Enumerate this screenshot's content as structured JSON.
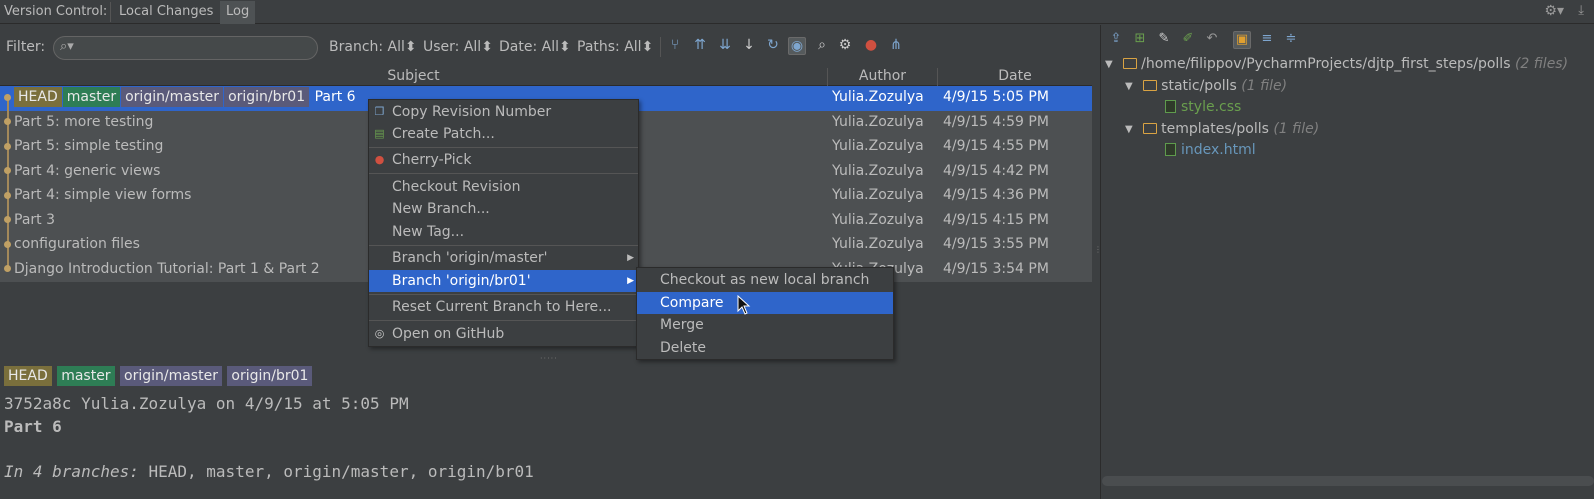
{
  "topbar": {
    "title": "Version Control:",
    "tabs": [
      "Local Changes",
      "Log"
    ],
    "active_tab": "Log"
  },
  "toolbar": {
    "filter_label": "Filter:",
    "filter_value": "",
    "branch": "Branch: All",
    "user": "User: All",
    "date": "Date: All",
    "paths": "Paths: All",
    "icons": [
      "graph-icon",
      "collapse-icon",
      "expand-icon",
      "arrow-down-icon",
      "refresh-icon",
      "highlight-icon",
      "search-icon",
      "gear-icon",
      "cherry-pick-icon",
      "columns-icon"
    ]
  },
  "table": {
    "headers": {
      "subject": "Subject",
      "author": "Author",
      "date": "Date"
    },
    "rows": [
      {
        "subject": "Part 6",
        "tags": [
          "HEAD",
          "master",
          "origin/master",
          "origin/br01"
        ],
        "author": "Yulia.Zozulya",
        "date": "4/9/15 5:05 PM",
        "selected": true
      },
      {
        "subject": "Part 5: more testing",
        "tags": [],
        "author": "Yulia.Zozulya",
        "date": "4/9/15 4:59 PM"
      },
      {
        "subject": "Part 5: simple testing",
        "tags": [],
        "author": "Yulia.Zozulya",
        "date": "4/9/15 4:55 PM"
      },
      {
        "subject": "Part 4: generic views",
        "tags": [],
        "author": "Yulia.Zozulya",
        "date": "4/9/15 4:42 PM"
      },
      {
        "subject": "Part 4: simple view forms",
        "tags": [],
        "author": "Yulia.Zozulya",
        "date": "4/9/15 4:36 PM"
      },
      {
        "subject": "Part 3",
        "tags": [],
        "author": "Yulia.Zozulya",
        "date": "4/9/15 4:15 PM"
      },
      {
        "subject": "configuration files",
        "tags": [],
        "author": "Yulia.Zozulya",
        "date": "4/9/15 3:55 PM"
      },
      {
        "subject": "Django Introduction Tutorial: Part 1 & Part 2",
        "tags": [],
        "author": "Yulia.Zozulya",
        "date": "4/9/15 3:54 PM"
      }
    ]
  },
  "context_menu": {
    "items": [
      {
        "label": "Copy Revision Number",
        "icon": "copy-icon"
      },
      {
        "label": "Create Patch...",
        "icon": "patch-icon"
      },
      {
        "label": "Cherry-Pick",
        "icon": "cherry-icon"
      },
      {
        "label": "Checkout Revision"
      },
      {
        "label": "New Branch..."
      },
      {
        "label": "New Tag..."
      },
      {
        "label": "Branch 'origin/master'",
        "submenu": true
      },
      {
        "label": "Branch 'origin/br01'",
        "submenu": true,
        "highlighted": true
      },
      {
        "label": "Reset Current Branch to Here..."
      },
      {
        "label": "Open on GitHub",
        "icon": "github-icon"
      }
    ]
  },
  "submenu": {
    "items": [
      {
        "label": "Checkout as new local branch"
      },
      {
        "label": "Compare",
        "highlighted": true
      },
      {
        "label": "Merge"
      },
      {
        "label": "Delete"
      }
    ]
  },
  "details": {
    "tags": [
      "HEAD",
      "master",
      "origin/master",
      "origin/br01"
    ],
    "line1": "3752a8c Yulia.Zozulya on 4/9/15 at 5:05 PM",
    "line2": "Part 6",
    "branches_prefix": "In 4 branches:",
    "branches_list": " HEAD, master, origin/master, origin/br01"
  },
  "changes_tree": {
    "root": "/home/filippov/PycharmProjects/djtp_first_steps/polls",
    "root_count": "(2 files)",
    "folders": [
      {
        "name": "static/polls",
        "count": "(1 file)",
        "files": [
          {
            "name": "style.css",
            "color": "#6a9f4e"
          }
        ]
      },
      {
        "name": "templates/polls",
        "count": "(1 file)",
        "files": [
          {
            "name": "index.html",
            "color": "#6897bb"
          }
        ]
      }
    ]
  },
  "colors": {
    "selection": "#2f65ca",
    "tag_head": "#7a6f3c",
    "tag_master": "#2e7d55",
    "tag_origin": "#5a5a7a",
    "background": "#3c3f41"
  }
}
